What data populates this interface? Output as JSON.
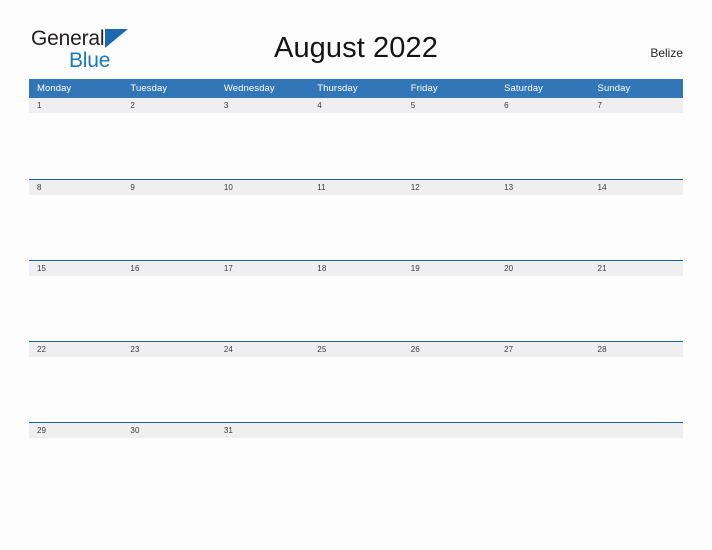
{
  "logo": {
    "line1": "General",
    "line2": "Blue",
    "triangle_icon": "blue-triangle-icon",
    "color_dark": "#231f20",
    "color_blue": "#1c79c0"
  },
  "header": {
    "title": "August 2022",
    "country": "Belize"
  },
  "colors": {
    "header_blue": "#3276b8",
    "row_line_blue": "#1f6098",
    "day_band_gray": "#efefef",
    "page_background": "#fdfdfd",
    "text_dark": "#141414"
  },
  "calendar": {
    "month": "August",
    "year": "2022",
    "weekday_headers": [
      "Monday",
      "Tuesday",
      "Wednesday",
      "Thursday",
      "Friday",
      "Saturday",
      "Sunday"
    ],
    "weeks": [
      [
        "1",
        "2",
        "3",
        "4",
        "5",
        "6",
        "7"
      ],
      [
        "8",
        "9",
        "10",
        "11",
        "12",
        "13",
        "14"
      ],
      [
        "15",
        "16",
        "17",
        "18",
        "19",
        "20",
        "21"
      ],
      [
        "22",
        "23",
        "24",
        "25",
        "26",
        "27",
        "28"
      ],
      [
        "29",
        "30",
        "31",
        "",
        "",
        "",
        ""
      ]
    ]
  }
}
